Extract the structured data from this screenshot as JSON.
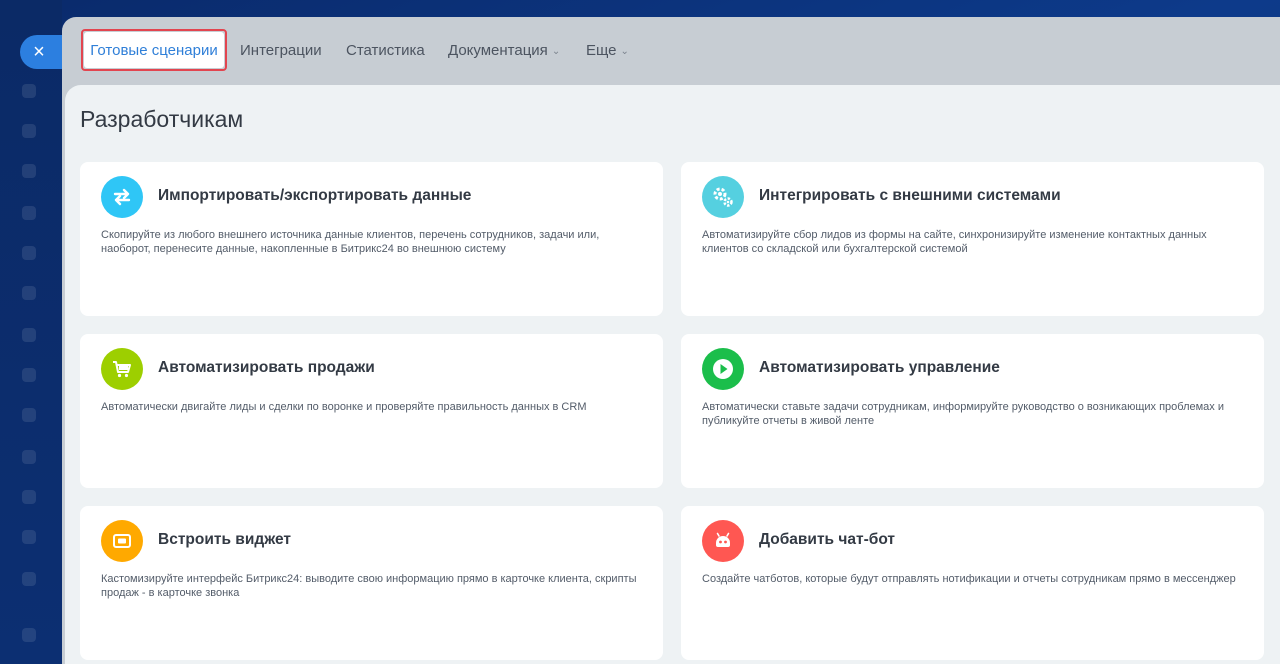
{
  "nav": {
    "close_label": "×",
    "active_tab": "Готовые сценарии",
    "tabs": [
      {
        "label": "Интеграции",
        "has_dropdown": false
      },
      {
        "label": "Статистика",
        "has_dropdown": false
      },
      {
        "label": "Документация",
        "has_dropdown": true
      },
      {
        "label": "Еще",
        "has_dropdown": true
      }
    ]
  },
  "page": {
    "title": "Разработчикам"
  },
  "cards": [
    {
      "title": "Импортировать/экспортировать данные",
      "description": "Скопируйте из любого внешнего источника данные клиентов, перечень сотрудников, задачи или, наоборот, перенесите данные, накопленные в Битрикс24 во внешнюю систему",
      "icon": "import-export-arrows-icon",
      "color": "#2fc6f6"
    },
    {
      "title": "Интегрировать с внешними системами",
      "description": "Автоматизируйте сбор лидов из формы на сайте, синхронизируйте изменение контактных данных клиентов со складской или бухгалтерской системой",
      "icon": "gears-icon",
      "color": "#55d0e0"
    },
    {
      "title": "Автоматизировать продажи",
      "description": "Автоматически двигайте лиды и сделки по воронке и проверяйте правильность данных в CRM",
      "icon": "cart-icon",
      "color": "#9dcf00"
    },
    {
      "title": "Автоматизировать управление",
      "description": "Автоматически ставьте задачи сотрудникам, информируйте руководство о возникающих проблемах и публикуйте отчеты в живой ленте",
      "icon": "play-icon",
      "color": "#1bbe4b"
    },
    {
      "title": "Встроить виджет",
      "description": "Кастомизируйте интерфейс Битрикс24: выводите свою информацию прямо в карточке клиента, скрипты продаж - в карточке звонка",
      "icon": "widget-icon",
      "color": "#ffa900"
    },
    {
      "title": "Добавить чат-бот",
      "description": "Создайте чатботов, которые будут отправлять нотификации и отчеты сотрудникам прямо в мессенджер",
      "icon": "bot-icon",
      "color": "#ff5752"
    }
  ]
}
